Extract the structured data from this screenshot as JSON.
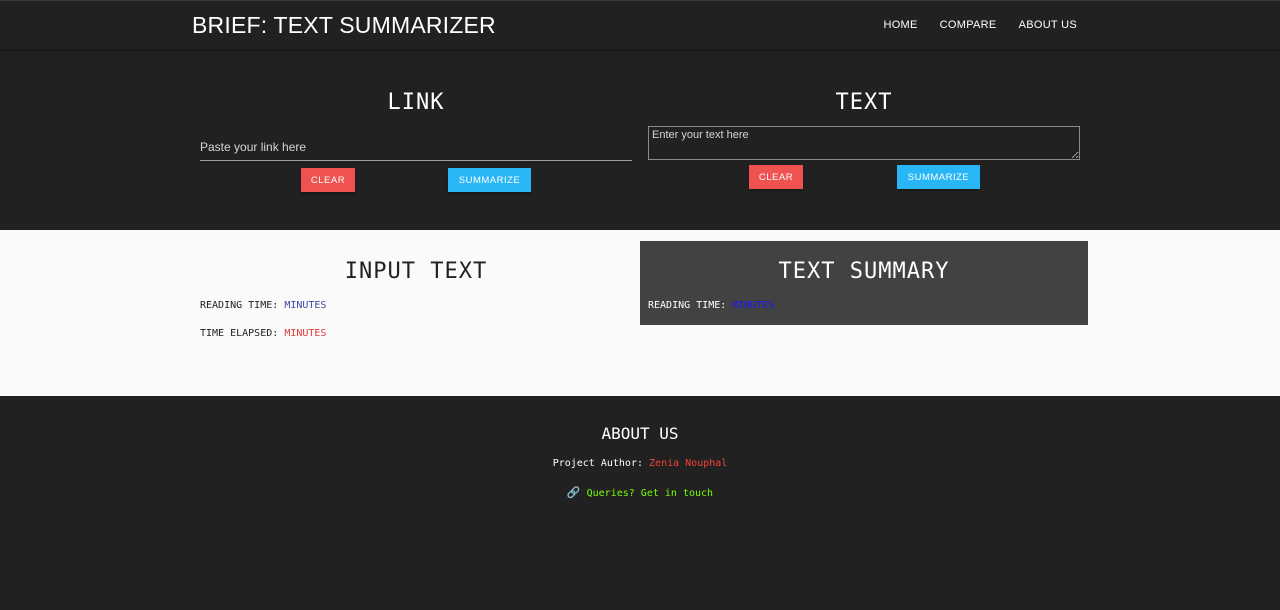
{
  "navbar": {
    "brand": "BRIEF: TEXT SUMMARIZER",
    "links": [
      "HOME",
      "COMPARE",
      "ABOUT US"
    ]
  },
  "link_panel": {
    "title": "LINK",
    "input_placeholder": "Paste your link here",
    "input_value": "",
    "clear_label": "CLEAR",
    "summarize_label": "SUMMARIZE"
  },
  "text_panel": {
    "title": "TEXT",
    "textarea_placeholder": "Enter your text here",
    "textarea_value": "",
    "clear_label": "CLEAR",
    "summarize_label": "SUMMARIZE"
  },
  "input_text": {
    "title": "INPUT TEXT",
    "reading_time_label": "READING TIME:",
    "reading_time_value": "MINUTES",
    "time_elapsed_label": "TIME ELAPSED:",
    "time_elapsed_value": "MINUTES"
  },
  "text_summary": {
    "title": "TEXT SUMMARY",
    "reading_time_label": "READING TIME:",
    "reading_time_value": "MINUTES"
  },
  "footer": {
    "title": "ABOUT US",
    "author_label": "Project Author:",
    "author_name": "Zenia Nouphal",
    "link_icon": "link-icon",
    "contact_text": "Queries? Get in touch"
  },
  "colors": {
    "background_dark": "#212121",
    "card_gray": "#424242",
    "clear_button": "#ef5350",
    "summarize_button": "#29b6f6",
    "author_name": "#f44336",
    "contact_link": "#76ff03"
  }
}
